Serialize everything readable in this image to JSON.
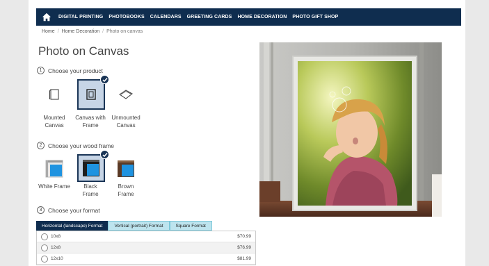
{
  "nav": {
    "items": [
      "DIGITAL PRINTING",
      "PHOTOBOOKS",
      "CALENDARS",
      "GREETING CARDS",
      "HOME DECORATION",
      "PHOTO GIFT SHOP"
    ]
  },
  "breadcrumb": [
    "Home",
    "Home Decoration",
    "Photo on canvas"
  ],
  "page_title": "Photo on Canvas",
  "steps": {
    "s1": {
      "num": "1",
      "label": "Choose your product"
    },
    "s2": {
      "num": "2",
      "label": "Choose your wood frame"
    },
    "s3": {
      "num": "3",
      "label": "Choose your format"
    }
  },
  "products": [
    {
      "label": "Mounted Canvas",
      "selected": false
    },
    {
      "label": "Canvas with Frame",
      "selected": true
    },
    {
      "label": "Unmounted Canvas",
      "selected": false
    }
  ],
  "frames": [
    {
      "label": "White Frame",
      "selected": false
    },
    {
      "label": "Black Frame",
      "selected": true
    },
    {
      "label": "Brown Frame",
      "selected": false
    }
  ],
  "format_tabs": [
    {
      "label": "Horizontal (landscape) Format",
      "active": true
    },
    {
      "label": "Vertical (portrait) Format",
      "active": false
    },
    {
      "label": "Square Format",
      "active": false
    }
  ],
  "sizes": [
    {
      "size": "10x8",
      "price": "$70.99"
    },
    {
      "size": "12x8",
      "price": "$76.99"
    },
    {
      "size": "12x10",
      "price": "$81.99"
    }
  ],
  "colors": {
    "nav": "#0f2d4f",
    "selected_bg": "#c7d5e6",
    "tab_inactive": "#bde4ee",
    "accent_blue": "#1f93e0"
  }
}
